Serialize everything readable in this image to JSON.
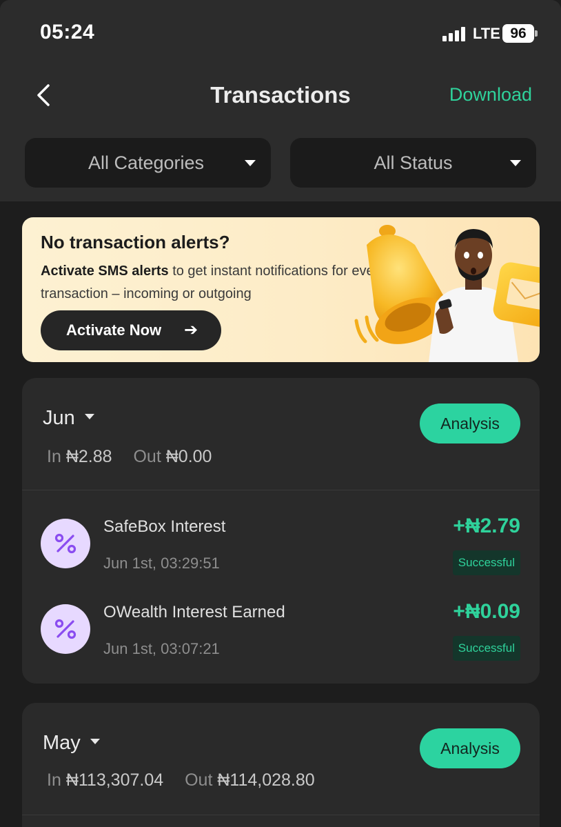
{
  "status_bar": {
    "time": "05:24",
    "network": "LTE",
    "battery": "96"
  },
  "header": {
    "title": "Transactions",
    "download_label": "Download"
  },
  "filters": {
    "category": "All Categories",
    "status": "All Status"
  },
  "banner": {
    "title": "No transaction alerts?",
    "desc_bold": "Activate SMS alerts",
    "desc_rest": " to get instant notifications for every transaction – incoming or outgoing",
    "button": "Activate Now",
    "notification_count": "1"
  },
  "months": [
    {
      "name": "Jun",
      "in_label": "In",
      "in_value": "₦2.88",
      "out_label": "Out",
      "out_value": "₦0.00",
      "analysis_label": "Analysis",
      "transactions": [
        {
          "title": "SafeBox Interest",
          "time": "Jun 1st, 03:29:51",
          "amount": "+₦2.79",
          "status": "Successful"
        },
        {
          "title": "OWealth Interest Earned",
          "time": "Jun 1st, 03:07:21",
          "amount": "+₦0.09",
          "status": "Successful"
        }
      ]
    },
    {
      "name": "May",
      "in_label": "In",
      "in_value": "₦113,307.04",
      "out_label": "Out",
      "out_value": "₦114,028.80",
      "analysis_label": "Analysis"
    }
  ],
  "colors": {
    "accent": "#2fd29b",
    "analysis_button": "#2cd3a0",
    "card": "#2a2a2a",
    "header": "#2c2c2c",
    "banner": "#fdecc7",
    "icon_bg": "#e7d9ff",
    "icon_fg": "#8a4cf0"
  },
  "icons": {
    "back": "chevron-left-icon",
    "transaction": "percent-icon",
    "caret": "caret-down-icon",
    "arrow": "arrow-right-icon"
  }
}
